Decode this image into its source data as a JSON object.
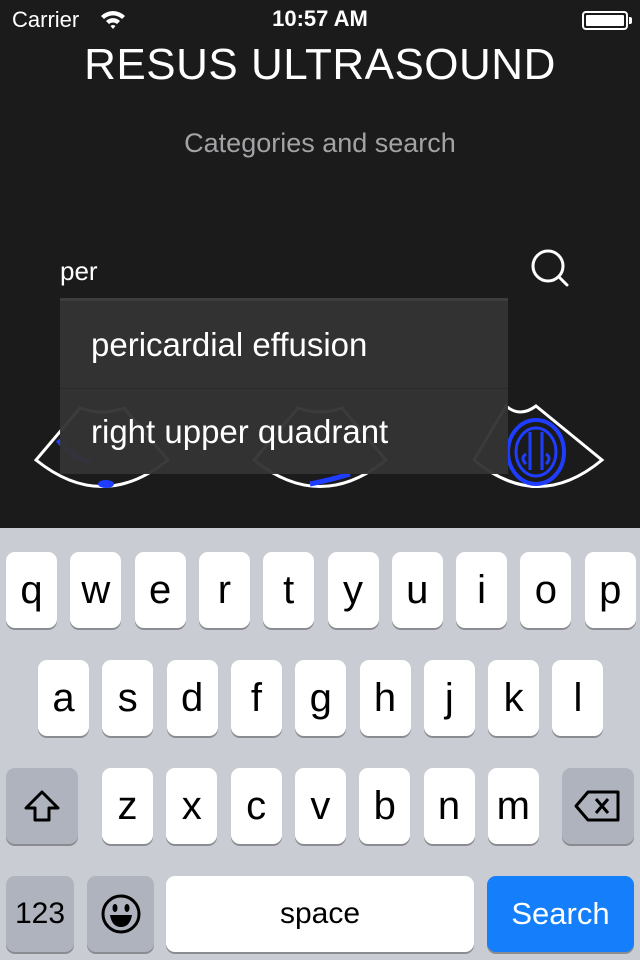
{
  "status_bar": {
    "carrier": "Carrier",
    "time": "10:57 AM",
    "battery_level": 1.0
  },
  "header": {
    "title": "RESUS ULTRASOUND",
    "subtitle": "Categories and search"
  },
  "search": {
    "value": "per",
    "icon": "search-icon"
  },
  "autocomplete": {
    "items": [
      {
        "label": "pericardial effusion"
      },
      {
        "label": "right upper quadrant"
      }
    ]
  },
  "categories": [
    {
      "icon": "ultrasound-probe-icon"
    },
    {
      "icon": "ultrasound-probe-icon"
    },
    {
      "icon": "ultrasound-brain-icon"
    }
  ],
  "colors": {
    "background": "#1b1b1b",
    "accent_blue": "#1a3cff",
    "keyboard_bg": "#c9ccd2",
    "search_key": "#147efb"
  },
  "keyboard": {
    "row1": [
      "q",
      "w",
      "e",
      "r",
      "t",
      "y",
      "u",
      "i",
      "o",
      "p"
    ],
    "row2": [
      "a",
      "s",
      "d",
      "f",
      "g",
      "h",
      "j",
      "k",
      "l"
    ],
    "row3": [
      "z",
      "x",
      "c",
      "v",
      "b",
      "n",
      "m"
    ],
    "numbers_label": "123",
    "space_label": "space",
    "return_label": "Search",
    "shift_icon": "shift-icon",
    "delete_icon": "backspace-icon",
    "emoji_icon": "emoji-icon"
  }
}
